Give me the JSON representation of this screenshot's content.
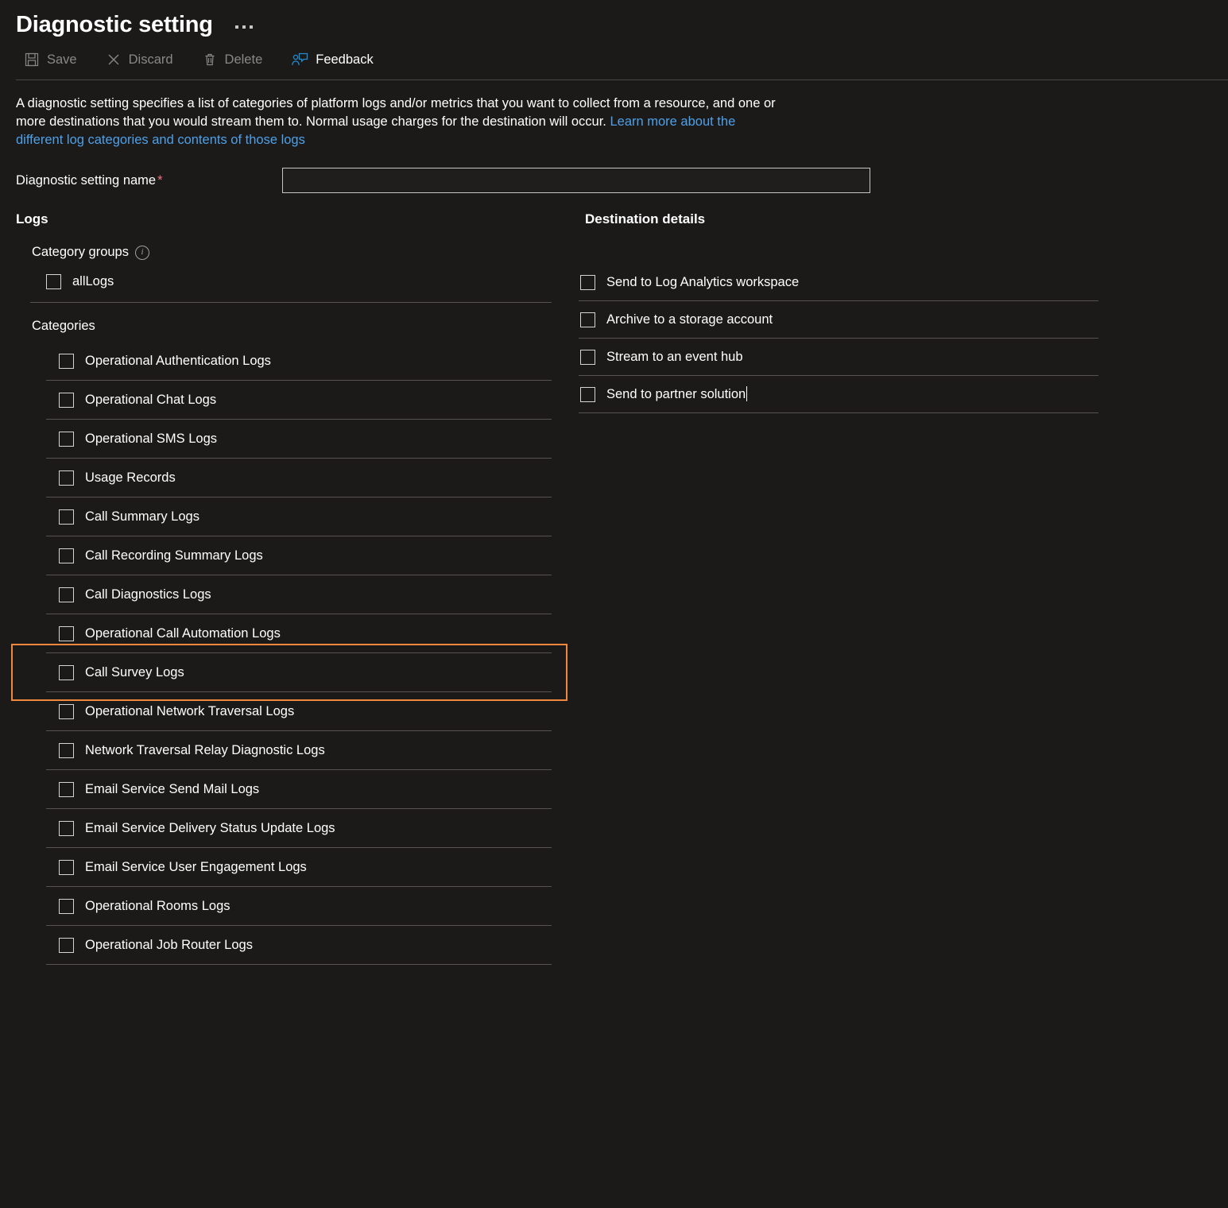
{
  "header": {
    "title": "Diagnostic setting",
    "overflow_icon": "ellipsis-icon"
  },
  "toolbar": {
    "items": [
      {
        "label": "Save",
        "icon": "save-icon",
        "enabled": false
      },
      {
        "label": "Discard",
        "icon": "discard-icon",
        "enabled": false
      },
      {
        "label": "Delete",
        "icon": "delete-icon",
        "enabled": false
      },
      {
        "label": "Feedback",
        "icon": "feedback-icon",
        "enabled": true
      }
    ]
  },
  "description": {
    "text_part1": "A diagnostic setting specifies a list of categories of platform logs and/or metrics that you want to collect from a resource, and one or more destinations that you would stream them to. Normal usage charges for the destination will occur. ",
    "link_text": "Learn more about the different log categories and contents of those logs"
  },
  "name_field": {
    "label": "Diagnostic setting name",
    "required_marker": "*",
    "value": "",
    "placeholder": ""
  },
  "logs": {
    "section_title": "Logs",
    "category_groups_label": "Category groups",
    "info_icon": "info-icon",
    "groups": [
      {
        "label": "allLogs",
        "checked": false
      }
    ],
    "categories_label": "Categories",
    "categories": [
      {
        "label": "Operational Authentication Logs",
        "checked": false,
        "highlighted": false
      },
      {
        "label": "Operational Chat Logs",
        "checked": false,
        "highlighted": false
      },
      {
        "label": "Operational SMS Logs",
        "checked": false,
        "highlighted": false
      },
      {
        "label": "Usage Records",
        "checked": false,
        "highlighted": false
      },
      {
        "label": "Call Summary Logs",
        "checked": false,
        "highlighted": false
      },
      {
        "label": "Call Recording Summary Logs",
        "checked": false,
        "highlighted": false
      },
      {
        "label": "Call Diagnostics Logs",
        "checked": false,
        "highlighted": false
      },
      {
        "label": "Operational Call Automation Logs",
        "checked": false,
        "highlighted": false
      },
      {
        "label": "Call Survey Logs",
        "checked": false,
        "highlighted": true
      },
      {
        "label": "Operational Network Traversal Logs",
        "checked": false,
        "highlighted": false
      },
      {
        "label": "Network Traversal Relay Diagnostic Logs",
        "checked": false,
        "highlighted": false
      },
      {
        "label": "Email Service Send Mail Logs",
        "checked": false,
        "highlighted": false
      },
      {
        "label": "Email Service Delivery Status Update Logs",
        "checked": false,
        "highlighted": false
      },
      {
        "label": "Email Service User Engagement Logs",
        "checked": false,
        "highlighted": false
      },
      {
        "label": "Operational Rooms Logs",
        "checked": false,
        "highlighted": false
      },
      {
        "label": "Operational Job Router Logs",
        "checked": false,
        "highlighted": false
      }
    ]
  },
  "destination": {
    "section_title": "Destination details",
    "items": [
      {
        "label": "Send to Log Analytics workspace",
        "checked": false,
        "caret": false
      },
      {
        "label": "Archive to a storage account",
        "checked": false,
        "caret": false
      },
      {
        "label": "Stream to an event hub",
        "checked": false,
        "caret": false
      },
      {
        "label": "Send to partner solution",
        "checked": false,
        "caret": true
      }
    ]
  },
  "colors": {
    "background": "#1b1a19",
    "highlight_border": "#f0883e",
    "link": "#4ea0e8",
    "accent_icon": "#1f8dd6",
    "separator": "#57534f",
    "disabled_text": "#8a8886",
    "required_star": "#f1707b"
  }
}
